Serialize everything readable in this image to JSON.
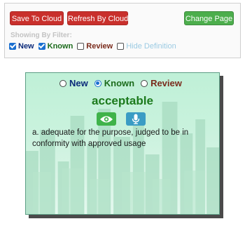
{
  "toolbar": {
    "save_label": "Save To Cloud",
    "refresh_label": "Refresh By Cloud",
    "change_page_label": "Change Page",
    "filter_heading": "Showing By Filter:",
    "filters": [
      {
        "label": "New",
        "checked": true
      },
      {
        "label": "Known",
        "checked": true
      },
      {
        "label": "Review",
        "checked": false
      },
      {
        "label": "Hide Definition",
        "checked": false
      }
    ]
  },
  "card": {
    "status_options": [
      {
        "label": "New",
        "selected": false
      },
      {
        "label": "Known",
        "selected": true
      },
      {
        "label": "Review",
        "selected": false
      }
    ],
    "word": "acceptable",
    "show_icon": "eye-icon",
    "speak_icon": "microphone-icon",
    "definition": "a. adequate for the purpose, judged to be in conformity with approved usage"
  },
  "colors": {
    "save_button": "#c9302c",
    "change_page_button": "#4cae4c",
    "word": "#1c7a1c",
    "card_background": "#c9f2dd"
  }
}
